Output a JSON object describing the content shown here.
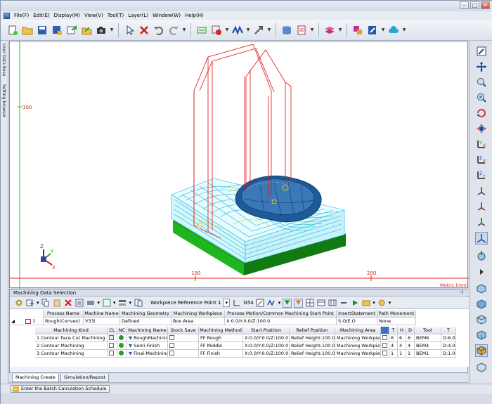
{
  "menu": [
    "File(F)",
    "Edit(E)",
    "Display(M)",
    "View(V)",
    "Tool(T)",
    "Layer(L)",
    "Window(W)",
    "Help(H)"
  ],
  "left_tabs": [
    "User Data Base",
    "Setting browser"
  ],
  "viewport": {
    "axis_100_v": "100",
    "axis_100_h": "100",
    "axis_200_h": "200",
    "units": "Metric (mm)",
    "axis_labels": {
      "z": "Z",
      "y": "Y",
      "x": "X"
    }
  },
  "panel": {
    "title": "Machining Data Selection",
    "toolbar": {
      "workpiece_label": "Workpiece Reference Point 1",
      "wcs_label": "G54"
    },
    "process_header": [
      "Process Name",
      "Machine Name",
      "Machining Geometry",
      "Machining Workpiece",
      "Process Motion/Common Machining Start Point",
      "InsertStatement",
      "Path Movement"
    ],
    "process_row": {
      "index": "1",
      "name": "Rough(Convex)",
      "machine": "V33i",
      "geometry": "Defined",
      "workpiece": "Box Area",
      "motion": "X:0.0/Y:0.0/Z:100.0",
      "insert": "S.O/E.O",
      "path": "None"
    },
    "machining_header": [
      "Machining Kind",
      "CL",
      "NC",
      "Machining Name",
      "Stock Save",
      "Machining Method",
      "Start Position",
      "Relief Position",
      "Machining Area",
      "T",
      "H",
      "D",
      "Tool",
      "T"
    ],
    "machining_rows": [
      {
        "index": "1",
        "kind": "Contour Face Cut Machining",
        "name": "RoughMachining",
        "method": "FF Rough",
        "start": "X:0.0/Y:0.0/Z:100.0",
        "relief": "Relief Height:100.0",
        "area": "Machining Workpiece",
        "t": "6",
        "h": "6",
        "d": "6",
        "tool": "BEM6",
        "tool_desc": "D:6.0 /"
      },
      {
        "index": "2",
        "kind": "Contour Machining",
        "name": "Semi-Finish",
        "method": "FF Middle",
        "start": "X:0.0/Y:0.0/Z:100.0",
        "relief": "Relief Height:100.0",
        "area": "Machining Workpiece",
        "t": "4",
        "h": "4",
        "d": "4",
        "tool": "BEM4",
        "tool_desc": "D:4.0 /"
      },
      {
        "index": "3",
        "kind": "Contour Machining",
        "name": "Final-Machining",
        "method": "FF Finish",
        "start": "X:0.0/Y:0.0/Z:100.0",
        "relief": "Relief Height:100.0",
        "area": "Machining Workpiece",
        "t": "1",
        "h": "1",
        "d": "1",
        "tool": "BEM1",
        "tool_desc": "D:1.0 /"
      }
    ]
  },
  "tabs": [
    "Machining Create",
    "Simulation/Repost"
  ],
  "status": {
    "batch_button": "Enter the Batch Calculation Schedule"
  },
  "colors": {
    "accent": "#2d5fa6",
    "toolpath": "#19b8d8",
    "path_red": "#e01010",
    "base_green": "#22cc22",
    "part_blue": "#1d5a9a"
  }
}
